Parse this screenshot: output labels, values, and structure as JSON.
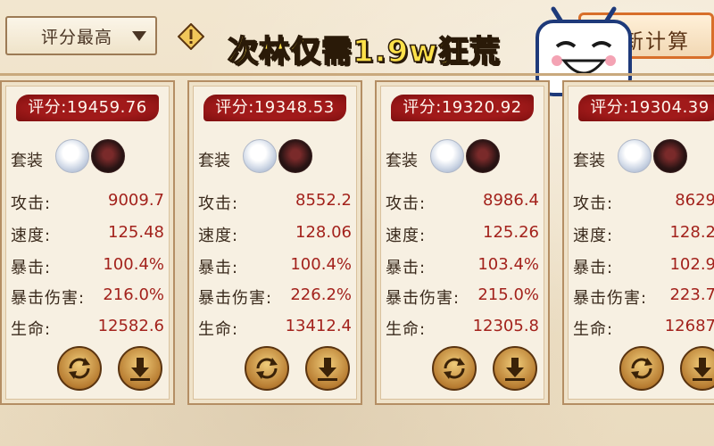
{
  "sort": {
    "selected": "评分最高"
  },
  "banner": "次林仅需1.9w狂荒",
  "recalc_label": "新计算",
  "stat_labels": {
    "set": "套装",
    "attack": "攻击:",
    "speed": "速度:",
    "crit": "暴击:",
    "crit_dmg": "暴击伤害:",
    "hp": "生命:"
  },
  "cards": [
    {
      "score": "评分:19459.76",
      "attack": "9009.7",
      "speed": "125.48",
      "crit": "100.4%",
      "crit_dmg": "216.0%",
      "hp": "12582.6"
    },
    {
      "score": "评分:19348.53",
      "attack": "8552.2",
      "speed": "128.06",
      "crit": "100.4%",
      "crit_dmg": "226.2%",
      "hp": "13412.4"
    },
    {
      "score": "评分:19320.92",
      "attack": "8986.4",
      "speed": "125.26",
      "crit": "103.4%",
      "crit_dmg": "215.0%",
      "hp": "12305.8"
    },
    {
      "score": "评分:19304.39",
      "attack": "8629",
      "speed": "128.2",
      "crit": "102.9",
      "crit_dmg": "223.7",
      "hp": "12687"
    }
  ],
  "colors": {
    "score_red": "#a11a1a",
    "value_red": "#a3221c",
    "accent_orange": "#d86f2a",
    "banner_yellow": "#ffe24a"
  },
  "icons": {
    "warning": "warning-diamond-icon",
    "mascot": "bilibili-tv-mascot-icon",
    "set_a": "white-hair-shikigami-avatar",
    "set_b": "dark-shikigami-avatar",
    "btn_left": "refresh-swap-icon",
    "btn_right": "download-arrow-icon"
  }
}
